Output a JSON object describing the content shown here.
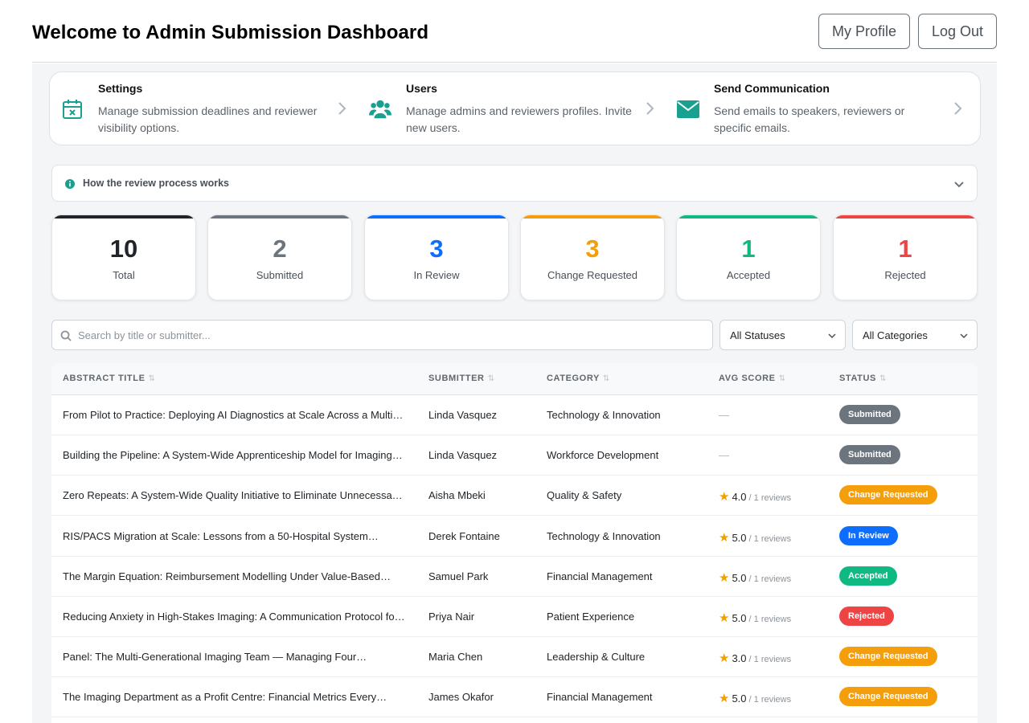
{
  "header": {
    "title": "Welcome to Admin Submission Dashboard",
    "profile_label": "My Profile",
    "logout_label": "Log Out"
  },
  "quick_links": [
    {
      "title": "Settings",
      "description": "Manage submission deadlines and reviewer visibility options.",
      "icon": "calendar-x-icon"
    },
    {
      "title": "Users",
      "description": "Manage admins and reviewers profiles. Invite new users.",
      "icon": "users-icon"
    },
    {
      "title": "Send Communication",
      "description": "Send emails to speakers, reviewers or specific emails.",
      "icon": "envelope-icon"
    }
  ],
  "review_process": {
    "label": "How the review process works"
  },
  "stats": [
    {
      "value": "10",
      "label": "Total",
      "color": "#212529"
    },
    {
      "value": "2",
      "label": "Submitted",
      "color": "#6c757d"
    },
    {
      "value": "3",
      "label": "In Review",
      "color": "#0d6efd"
    },
    {
      "value": "3",
      "label": "Change Requested",
      "color": "#f59e0b"
    },
    {
      "value": "1",
      "label": "Accepted",
      "color": "#10b981"
    },
    {
      "value": "1",
      "label": "Rejected",
      "color": "#ef4444"
    }
  ],
  "filters": {
    "search_placeholder": "Search by title or submitter...",
    "status_selected": "All Statuses",
    "category_selected": "All Categories"
  },
  "table": {
    "columns": [
      "Abstract Title",
      "Submitter",
      "Category",
      "Avg Score",
      "Status"
    ],
    "rows": [
      {
        "title": "From Pilot to Practice: Deploying AI Diagnostics at Scale Across a Multi…",
        "submitter": "Linda Vasquez",
        "category": "Technology & Innovation",
        "score": "—",
        "reviews": "",
        "status": "Submitted"
      },
      {
        "title": "Building the Pipeline: A System-Wide Apprenticeship Model for Imaging…",
        "submitter": "Linda Vasquez",
        "category": "Workforce Development",
        "score": "—",
        "reviews": "",
        "status": "Submitted"
      },
      {
        "title": "Zero Repeats: A System-Wide Quality Initiative to Eliminate Unnecessa…",
        "submitter": "Aisha Mbeki",
        "category": "Quality & Safety",
        "score": "4.0",
        "reviews": "/ 1 reviews",
        "status": "Change Requested"
      },
      {
        "title": "RIS/PACS Migration at Scale: Lessons from a 50-Hospital System…",
        "submitter": "Derek Fontaine",
        "category": "Technology & Innovation",
        "score": "5.0",
        "reviews": "/ 1 reviews",
        "status": "In Review"
      },
      {
        "title": "The Margin Equation: Reimbursement Modelling Under Value-Based…",
        "submitter": "Samuel Park",
        "category": "Financial Management",
        "score": "5.0",
        "reviews": "/ 1 reviews",
        "status": "Accepted"
      },
      {
        "title": "Reducing Anxiety in High-Stakes Imaging: A Communication Protocol fo…",
        "submitter": "Priya Nair",
        "category": "Patient Experience",
        "score": "5.0",
        "reviews": "/ 1 reviews",
        "status": "Rejected"
      },
      {
        "title": "Panel: The Multi-Generational Imaging Team — Managing Four…",
        "submitter": "Maria Chen",
        "category": "Leadership & Culture",
        "score": "3.0",
        "reviews": "/ 1 reviews",
        "status": "Change Requested"
      },
      {
        "title": "The Imaging Department as a Profit Centre: Financial Metrics Every…",
        "submitter": "James Okafor",
        "category": "Financial Management",
        "score": "5.0",
        "reviews": "/ 1 reviews",
        "status": "Change Requested"
      }
    ]
  },
  "status_colors": {
    "Submitted": "#6c757d",
    "In Review": "#0d6efd",
    "Change Requested": "#f59e0b",
    "Accepted": "#10b981",
    "Rejected": "#ef4444"
  },
  "accent_color": "#1aa08f"
}
